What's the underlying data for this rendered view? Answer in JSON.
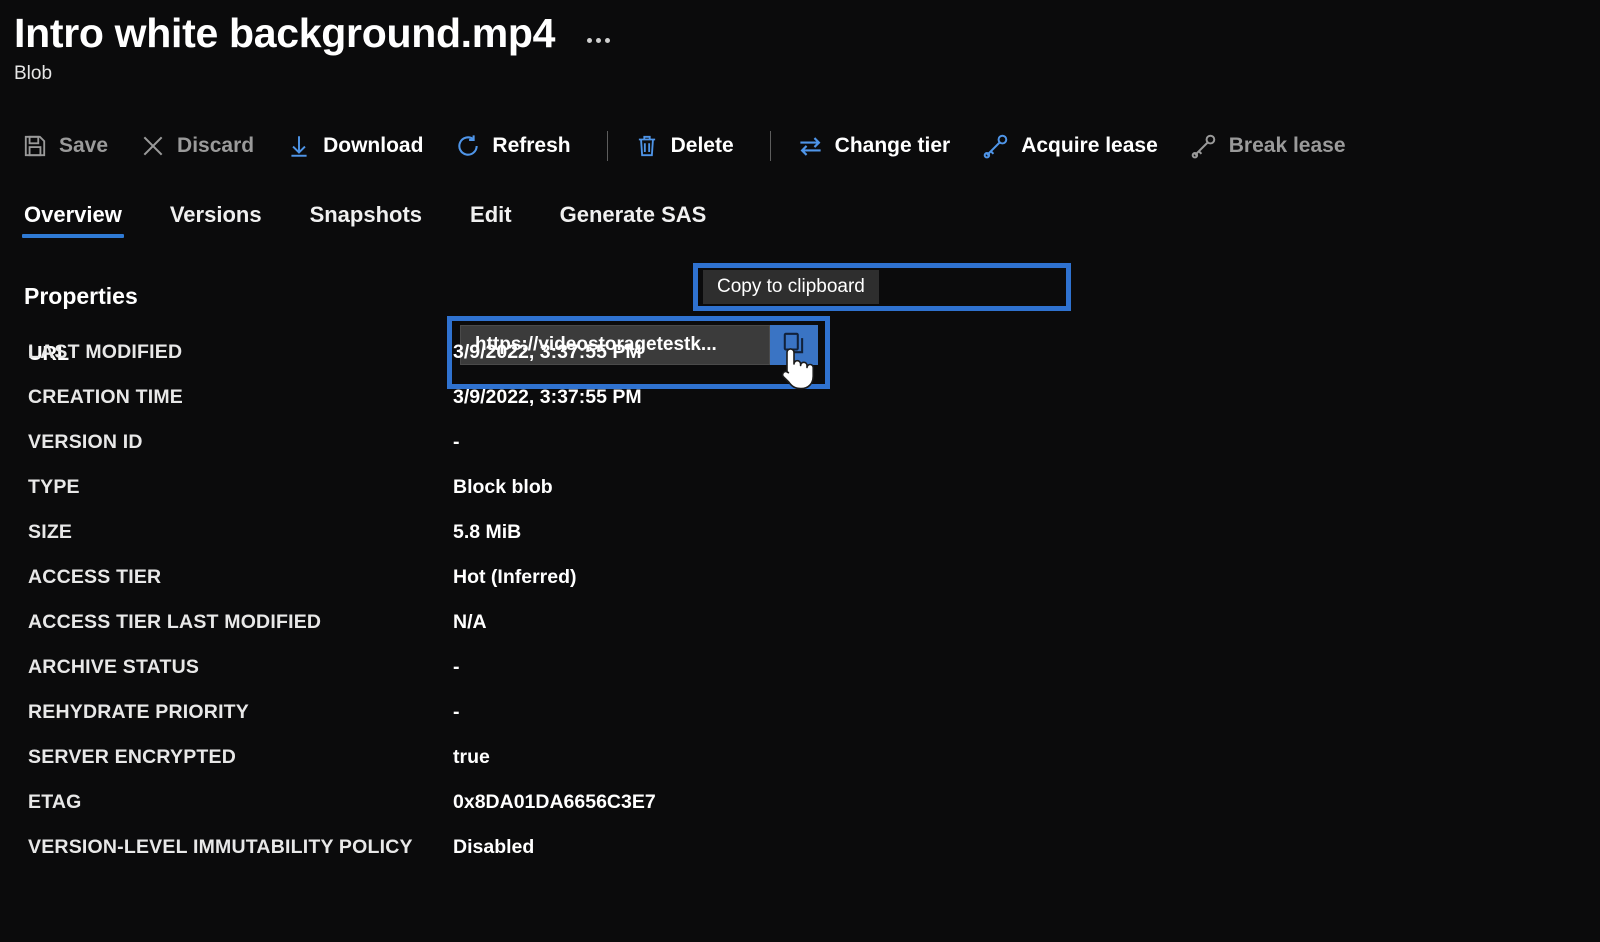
{
  "header": {
    "title": "Intro white background.mp4",
    "subtitle": "Blob",
    "more_menu": "..."
  },
  "toolbar": {
    "items": [
      {
        "label": "Save",
        "icon": "save-icon",
        "enabled": false
      },
      {
        "label": "Discard",
        "icon": "close-icon",
        "enabled": false
      },
      {
        "label": "Download",
        "icon": "download-icon",
        "enabled": true
      },
      {
        "label": "Refresh",
        "icon": "refresh-icon",
        "enabled": true
      },
      {
        "label": "Delete",
        "icon": "trash-icon",
        "enabled": true
      },
      {
        "label": "Change tier",
        "icon": "swap-arrows-icon",
        "enabled": true
      },
      {
        "label": "Acquire lease",
        "icon": "key-icon",
        "enabled": true
      },
      {
        "label": "Break lease",
        "icon": "key-broken-icon",
        "enabled": false
      }
    ]
  },
  "tabs": {
    "items": [
      {
        "label": "Overview",
        "active": true
      },
      {
        "label": "Versions",
        "active": false
      },
      {
        "label": "Snapshots",
        "active": false
      },
      {
        "label": "Edit",
        "active": false
      },
      {
        "label": "Generate SAS",
        "active": false
      }
    ]
  },
  "properties": {
    "section_title": "Properties",
    "url": {
      "label": "URL",
      "value": "https://videostoragetestk...",
      "copy_icon": "copy-icon"
    },
    "rows": [
      {
        "label": "LAST MODIFIED",
        "value": "3/9/2022, 3:37:55 PM"
      },
      {
        "label": "CREATION TIME",
        "value": "3/9/2022, 3:37:55 PM"
      },
      {
        "label": "VERSION ID",
        "value": "-"
      },
      {
        "label": "TYPE",
        "value": "Block blob"
      },
      {
        "label": "SIZE",
        "value": "5.8 MiB"
      },
      {
        "label": "ACCESS TIER",
        "value": "Hot (Inferred)"
      },
      {
        "label": "ACCESS TIER LAST MODIFIED",
        "value": "N/A"
      },
      {
        "label": "ARCHIVE STATUS",
        "value": "-"
      },
      {
        "label": "REHYDRATE PRIORITY",
        "value": "-"
      },
      {
        "label": "SERVER ENCRYPTED",
        "value": "true"
      },
      {
        "label": "ETAG",
        "value": "0x8DA01DA6656C3E7"
      },
      {
        "label": "VERSION-LEVEL IMMUTABILITY POLICY",
        "value": "Disabled"
      }
    ]
  },
  "tooltip": {
    "text": "Copy to clipboard"
  },
  "colors": {
    "background": "#0b0b0c",
    "accent_blue": "#2f7ad4",
    "annotation_blue": "#2f72d0",
    "copy_button_blue": "#3a74c4",
    "input_background": "#3b3b3b",
    "tooltip_background": "#2e2e2e",
    "disabled_text": "#9a9a9a",
    "text": "#ffffff"
  }
}
